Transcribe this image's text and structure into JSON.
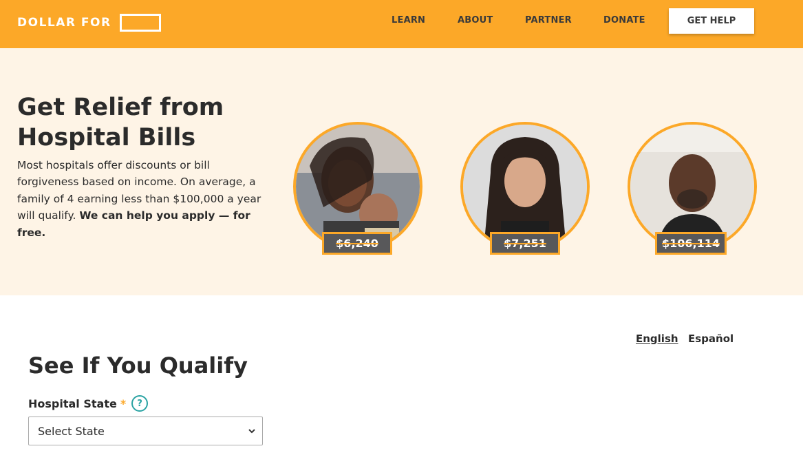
{
  "header": {
    "logo_text": "DOLLAR FOR",
    "nav": [
      {
        "label": "LEARN",
        "name": "nav-learn"
      },
      {
        "label": "ABOUT",
        "name": "nav-about"
      },
      {
        "label": "PARTNER",
        "name": "nav-partner"
      },
      {
        "label": "DONATE",
        "name": "nav-donate"
      }
    ],
    "cta": "GET HELP"
  },
  "hero": {
    "title": "Get Relief from Hospital Bills",
    "text_plain": "Most hospitals offer discounts or bill forgiveness based on income. On average, a family of 4 earning less than $100,000 a year will qualify. ",
    "text_bold": "We can help you apply — for free.",
    "people": [
      {
        "amount": "$6,240"
      },
      {
        "amount": "$7,251"
      },
      {
        "amount": "$106,114"
      }
    ]
  },
  "languages": {
    "english": "English",
    "spanish": "Español"
  },
  "form": {
    "title": "See If You Qualify",
    "state_label": "Hospital State",
    "required_mark": "*",
    "help_glyph": "?",
    "state_select_value": "Select State"
  },
  "colors": {
    "brand": "#fca828",
    "hero_bg": "#fef4e6",
    "help_teal": "#2aa3a3",
    "tag_bg": "#58585a"
  },
  "icons": {
    "help": "question-circle-icon",
    "select": "chevron-down-icon"
  }
}
